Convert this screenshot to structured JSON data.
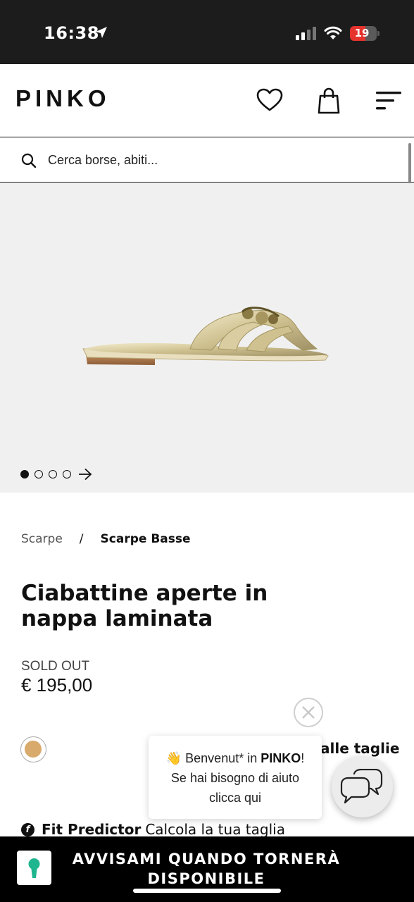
{
  "status_bar": {
    "time": "16:38",
    "battery": "19"
  },
  "header": {
    "logo": "PINKO",
    "icons": [
      "heart-icon",
      "shopping-bag-icon",
      "menu-icon"
    ]
  },
  "search": {
    "placeholder": "Cerca borse, abiti..."
  },
  "gallery": {
    "image_count": 4,
    "active_index": 0
  },
  "breadcrumb": {
    "parent": "Scarpe",
    "separator": "/",
    "current": "Scarpe Basse"
  },
  "product": {
    "title": "Ciabattine aperte in nappa laminata",
    "availability": "SOLD OUT",
    "price": "€ 195,00",
    "color_swatch": "#d8aa6c",
    "size_guide_label": "alle taglie",
    "fit_predictor_label": "Fit Predictor",
    "fit_predictor_action": "Calcola la tua taglia"
  },
  "chat": {
    "greeting_emoji": "👋",
    "greeting_prefix": "Benvenut* in",
    "brand": "PINKO",
    "greeting_suffix": "!",
    "help_line1": "Se hai bisogno di aiuto",
    "help_line2": "clicca qui"
  },
  "bottom_bar": {
    "notify_line1": "AVVISAMI QUANDO TORNERÀ",
    "notify_line2": "DISPONIBILE",
    "accent_color": "#1fb58f"
  }
}
